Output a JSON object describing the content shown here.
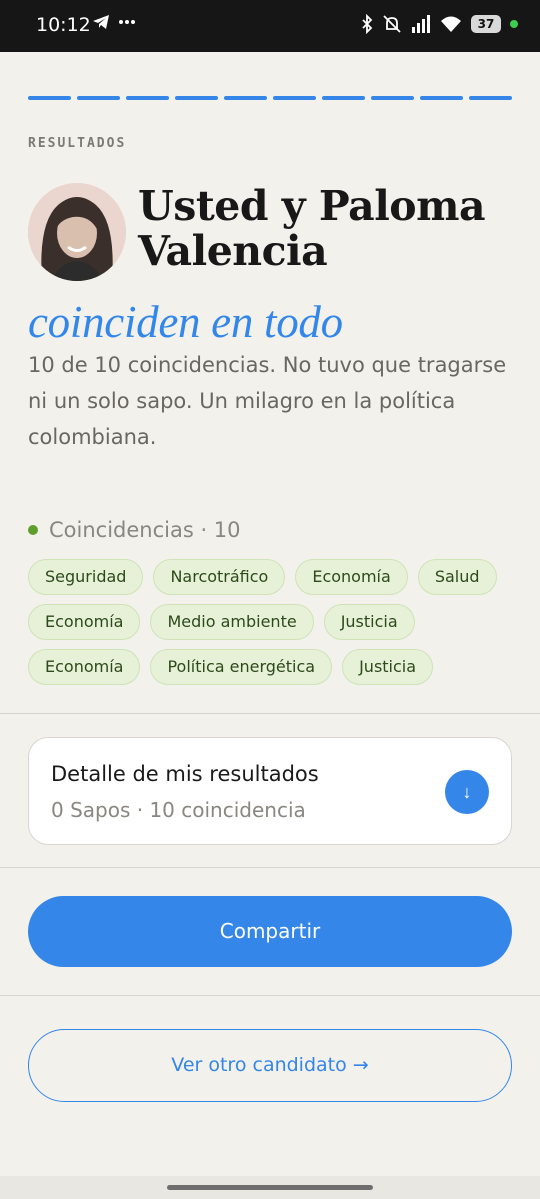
{
  "status_bar": {
    "time": "10:12",
    "left_icons": [
      "telegram-icon",
      "more-icon"
    ],
    "right_icons": [
      "bluetooth-icon",
      "mute-icon",
      "signal-icon",
      "wifi-icon"
    ],
    "battery": "37"
  },
  "progress": {
    "total_steps": 10,
    "completed_steps": 10,
    "color": "#3486e8"
  },
  "results": {
    "eyebrow": "RESULTADOS",
    "headline": "Usted y Paloma Valencia",
    "subheadline": "coinciden en todo",
    "description": "10 de 10 coincidencias. No tuvo que tragarse ni un solo sapo. Un milagro en la política colombiana."
  },
  "coincidences": {
    "heading": "Coincidencias · 10",
    "tags": [
      "Seguridad",
      "Narcotráfico",
      "Economía",
      "Salud",
      "Economía",
      "Medio ambiente",
      "Justicia",
      "Economía",
      "Política energética",
      "Justicia"
    ]
  },
  "detail": {
    "title": "Detalle de mis resultados",
    "subtitle": "0 Sapos · 10 coincidencia",
    "toggle_icon": "↓"
  },
  "actions": {
    "share_label": "Compartir",
    "other_label": "Ver otro candidato →"
  },
  "colors": {
    "accent": "#3486e8",
    "tag_bg": "#e6f1d8",
    "tag_text": "#2d4a1b",
    "dot_green": "#5f9e2c",
    "background": "#f3f1ec"
  }
}
